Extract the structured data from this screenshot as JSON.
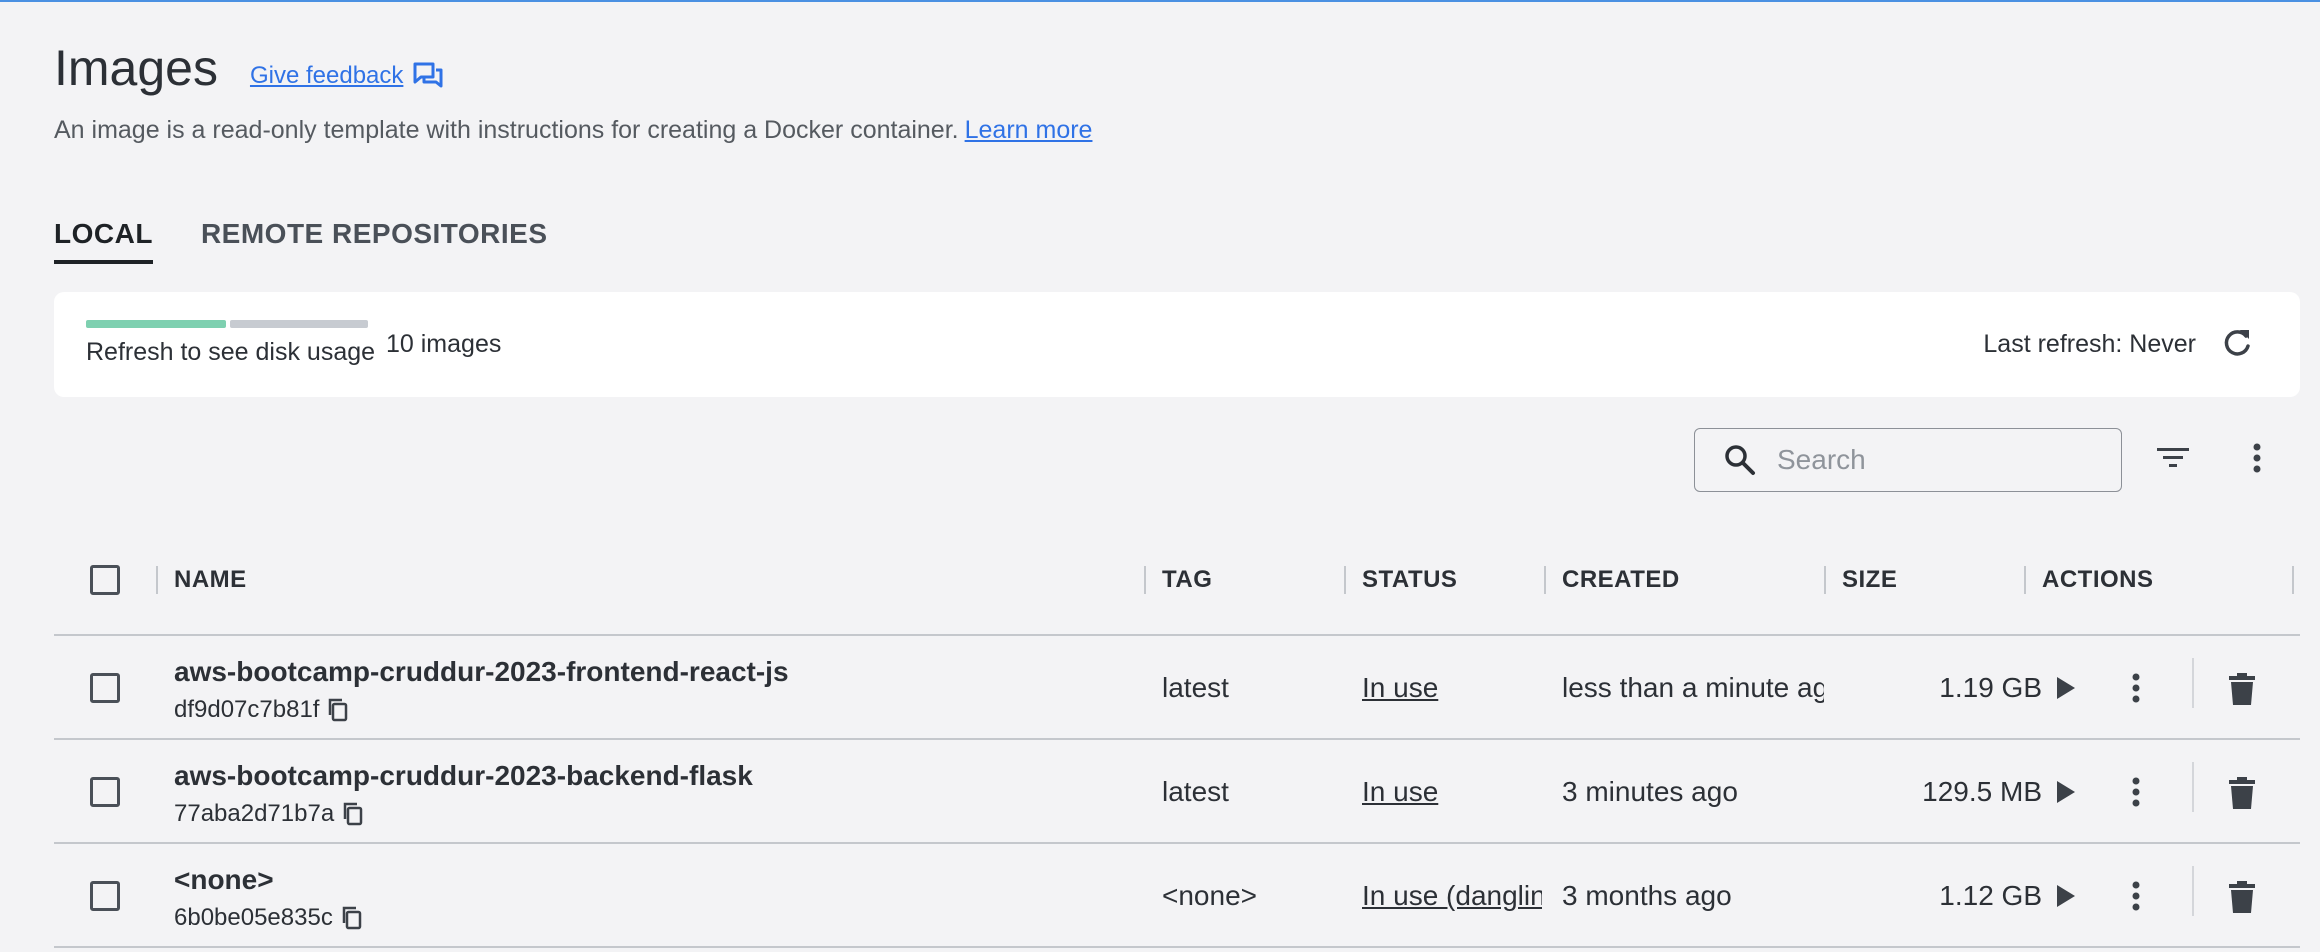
{
  "header": {
    "title": "Images",
    "feedback_label": "Give feedback",
    "description": "An image is a read-only template with instructions for creating a Docker container.",
    "learn_more": "Learn more"
  },
  "tabs": [
    {
      "label": "LOCAL",
      "active": true
    },
    {
      "label": "REMOTE REPOSITORIES",
      "active": false
    }
  ],
  "disk": {
    "label": "Refresh to see disk usage",
    "image_count": "10 images",
    "last_refresh": "Last refresh: Never"
  },
  "toolbar": {
    "search_placeholder": "Search"
  },
  "table": {
    "columns": [
      "NAME",
      "TAG",
      "STATUS",
      "CREATED",
      "SIZE",
      "ACTIONS"
    ],
    "rows": [
      {
        "name": "aws-bootcamp-cruddur-2023-frontend-react-js",
        "id": "df9d07c7b81f",
        "tag": "latest",
        "status": "In use",
        "created": "less than a minute ago",
        "size": "1.19 GB"
      },
      {
        "name": "aws-bootcamp-cruddur-2023-backend-flask",
        "id": "77aba2d71b7a",
        "tag": "latest",
        "status": "In use",
        "created": "3 minutes ago",
        "size": "129.5 MB"
      },
      {
        "name": "<none>",
        "id": "6b0be05e835c",
        "tag": "<none>",
        "status": "In use (dangling)",
        "created": "3 months ago",
        "size": "1.12 GB"
      }
    ]
  },
  "colors": {
    "accent": "#2f72e6",
    "disk_used": "#7ed0b0",
    "disk_free": "#c7cbd1",
    "top_border": "#4a90e2"
  }
}
